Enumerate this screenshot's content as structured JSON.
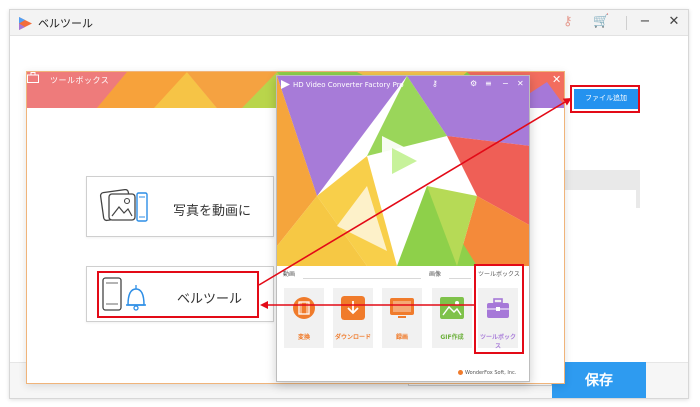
{
  "app": {
    "title": "ベルツール",
    "save_label": "保存",
    "controls": {
      "minimize": "−",
      "maximize": "☐",
      "close": "✕"
    },
    "icons": [
      "key-icon",
      "cart-icon",
      "app-logo-icon"
    ]
  },
  "toolbox": {
    "title": "ツールボックス",
    "close": "✕",
    "cards": [
      {
        "label": "写真を動画に",
        "icon": "photo-to-video-icon"
      },
      {
        "label": "ベルツール",
        "icon": "phone-bell-icon"
      }
    ]
  },
  "converter": {
    "title": "HD Video Converter Factory Pro",
    "controls": {
      "minimize": "−",
      "close": "✕"
    },
    "sections": {
      "video": "動画",
      "image": "画像",
      "toolbox": "ツールボックス"
    },
    "tiles": [
      {
        "label": "変換",
        "icon": "convert-film-icon"
      },
      {
        "label": "ダウンロード",
        "icon": "download-icon"
      },
      {
        "label": "録画",
        "icon": "screen-record-icon"
      },
      {
        "label": "GIF作成",
        "icon": "gif-maker-icon"
      },
      {
        "label": "ツールボックス",
        "icon": "toolbox-icon"
      }
    ],
    "footer": "WonderFox Soft, Inc."
  },
  "annotation": {
    "add_file_label": "ファイル追加"
  },
  "colors": {
    "accent_blue": "#2e9bf0",
    "highlight_red": "#e30a17",
    "banner_orange": "#f7a23b",
    "banner_red": "#ef5f5a",
    "banner_purple": "#a678d8",
    "banner_green": "#8ed04a"
  }
}
